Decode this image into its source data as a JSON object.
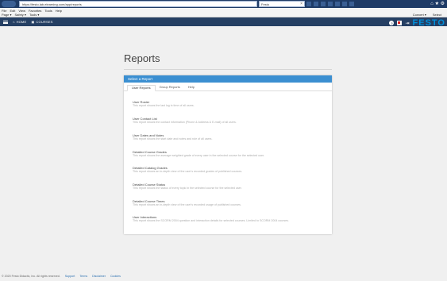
{
  "browser": {
    "url": "https://festo.lab.elearning.com/app/reports",
    "tab_label": "Festo",
    "menu": [
      "File",
      "Edit",
      "View",
      "Favorites",
      "Tools",
      "Help"
    ],
    "tools": [
      "Page ▾",
      "Safety ▾",
      "Tools ▾"
    ],
    "tools_right": [
      "Convert ▾",
      "Select"
    ]
  },
  "header": {
    "nav": [
      {
        "label": "HOME",
        "icon": "home-icon"
      },
      {
        "label": "COURSES",
        "icon": "courses-icon"
      }
    ],
    "help_label": "?",
    "logo": "FESTO"
  },
  "page": {
    "title": "Reports"
  },
  "card": {
    "heading": "Select a Report",
    "tabs": [
      {
        "label": "User Reports",
        "active": true
      },
      {
        "label": "Group Reports",
        "active": false
      },
      {
        "label": "Help",
        "active": false
      }
    ],
    "reports": [
      {
        "title": "User Roster",
        "desc": "This report shows the last log in time of all users."
      },
      {
        "title": "User Contact List",
        "desc": "This report shows the contact information (Phone & Address & E-mail) of all users."
      },
      {
        "title": "User Dates and Notes",
        "desc": "This report shows the start date and notes and role of all users."
      },
      {
        "title": "Detailed Course Grades",
        "desc": "This report shows the average weighted grade of every user in the selected course for the selected user."
      },
      {
        "title": "Detailed Catalog Grades",
        "desc": "This report shows an in-depth view of the user's recorded grades of published courses."
      },
      {
        "title": "Detailed Course Status",
        "desc": "This report shows the status of every topic in the selected course for the selected user."
      },
      {
        "title": "Detailed Course Times",
        "desc": "This report shows an in-depth view of the user's recorded usage of published courses."
      },
      {
        "title": "User Interactions",
        "desc": "This report shows the SCORM 2004 question and interaction details for selected courses. Limited to SCORM 2004 courses."
      }
    ]
  },
  "footer": {
    "copyright": "© 2020 Festo Didactic, Inc. All rights reserved.",
    "links": [
      "Support",
      "Terms",
      "Disclaimer",
      "Cookies"
    ]
  }
}
